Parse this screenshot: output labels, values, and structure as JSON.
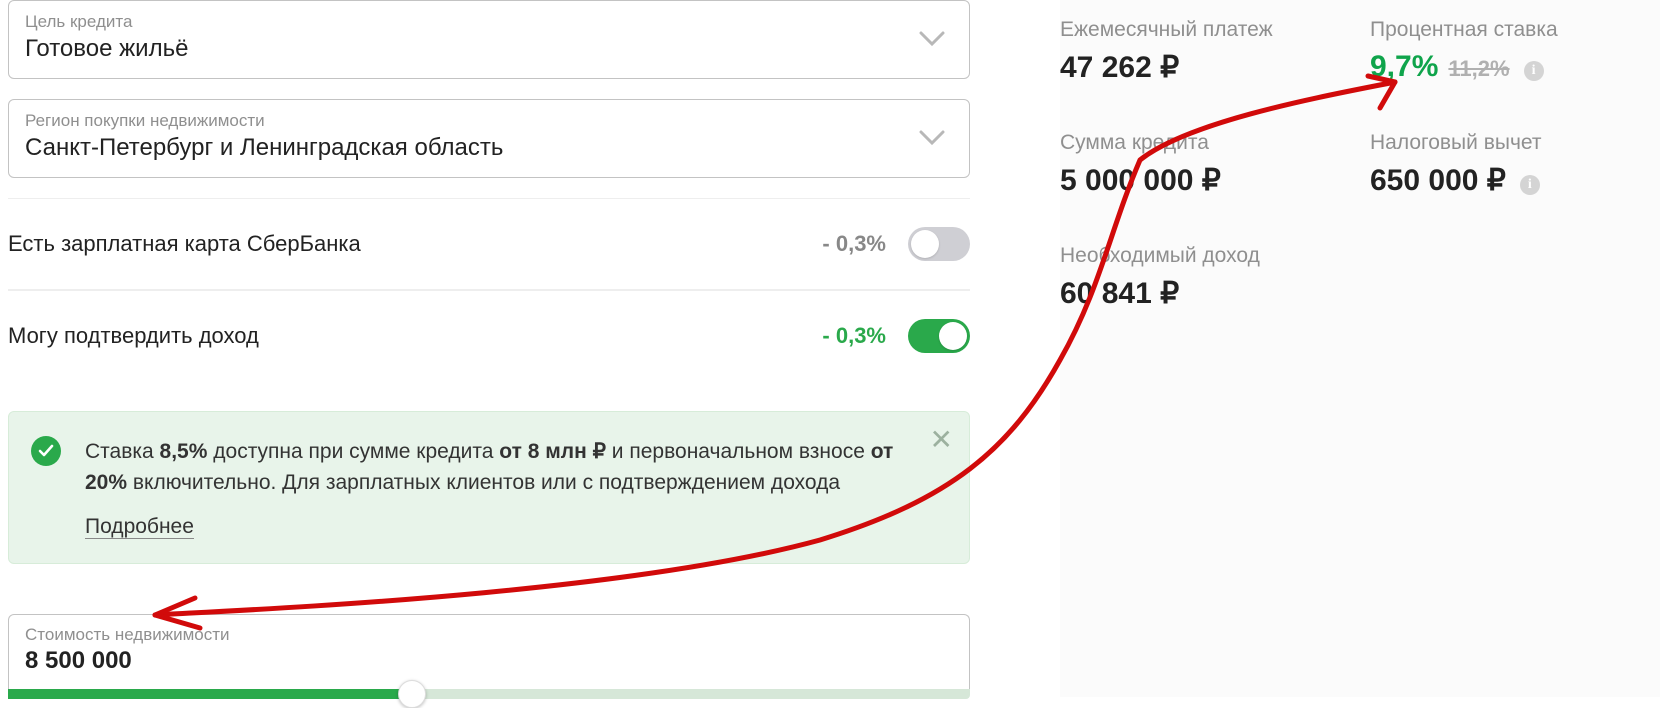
{
  "left": {
    "loan_purpose": {
      "label": "Цель кредита",
      "value": "Готовое жильё"
    },
    "region": {
      "label": "Регион покупки недвижимости",
      "value": "Санкт-Петербург и Ленинградская область"
    },
    "toggles": {
      "salary_card": {
        "label": "Есть зарплатная карта СберБанка",
        "discount": "- 0,3%"
      },
      "confirm_income": {
        "label": "Могу подтвердить доход",
        "discount": "- 0,3%"
      }
    },
    "banner": {
      "text_prefix": "Ставка ",
      "rate": "8,5%",
      "text_mid1": " доступна при сумме кредита ",
      "from_amount": "от 8 млн ₽",
      "text_mid2": " и первоначальном взносе ",
      "dp": "от 20%",
      "text_suffix": " включительно. Для зарплатных клиентов или с подтверждением дохода",
      "details": "Подробнее"
    },
    "cost": {
      "label": "Стоимость недвижимости",
      "value": "8 500 000"
    }
  },
  "right": {
    "monthly": {
      "label": "Ежемесячный платеж",
      "value": "47 262 ₽"
    },
    "rate": {
      "label": "Процентная ставка",
      "value": "9,7%",
      "old": "11,2%"
    },
    "loan_sum": {
      "label": "Сумма кредита",
      "value": "5 000 000 ₽"
    },
    "tax_deduct": {
      "label": "Налоговый вычет",
      "value": "650 000 ₽"
    },
    "required_income": {
      "label": "Необходимый доход",
      "value": "60 841 ₽"
    }
  }
}
